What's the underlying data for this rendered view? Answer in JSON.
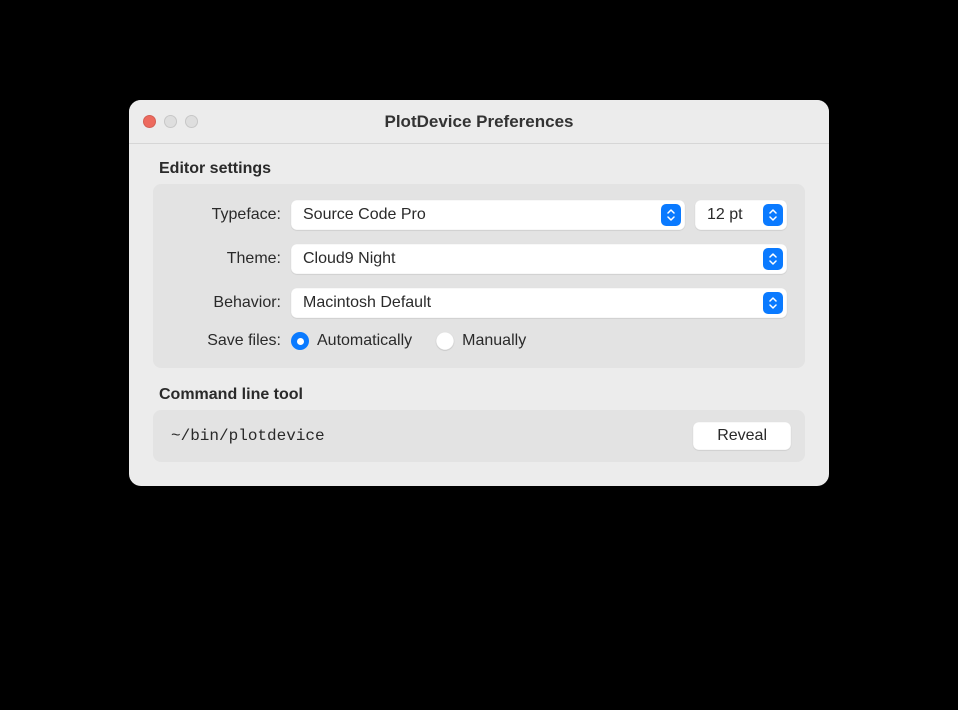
{
  "window": {
    "title": "PlotDevice Preferences"
  },
  "editor": {
    "heading": "Editor settings",
    "typeface_label": "Typeface:",
    "typeface_value": "Source Code Pro",
    "fontsize_value": "12 pt",
    "theme_label": "Theme:",
    "theme_value": "Cloud9 Night",
    "behavior_label": "Behavior:",
    "behavior_value": "Macintosh Default",
    "save_label": "Save files:",
    "save_auto": "Automatically",
    "save_manual": "Manually",
    "save_selected": "auto"
  },
  "cli": {
    "heading": "Command line tool",
    "path": "~/bin/plotdevice",
    "reveal_label": "Reveal"
  },
  "colors": {
    "accent": "#0a7aff",
    "close": "#ed6a5e"
  }
}
